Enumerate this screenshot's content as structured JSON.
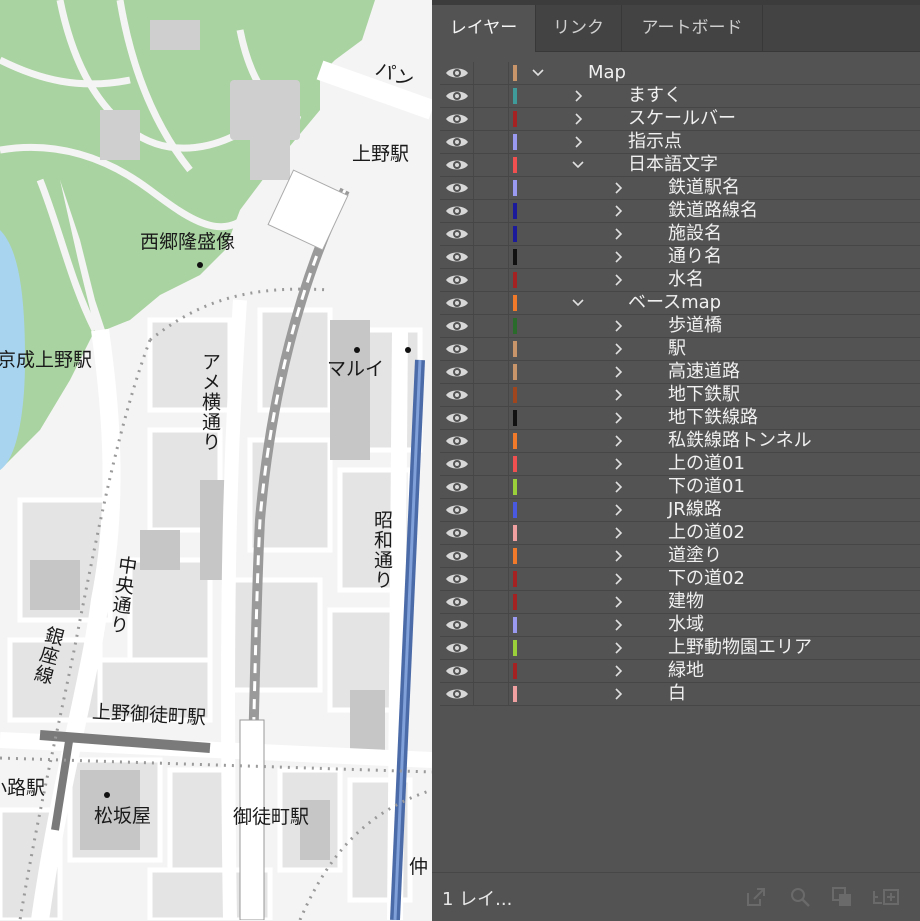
{
  "map": {
    "labels": {
      "pan": "パン",
      "ueno_station": "上野駅",
      "saigo": "西郷隆盛像",
      "keisei": "京成上野駅",
      "ame": "アメ横通り",
      "marui": "マルイ",
      "chuo": "中央通り",
      "showa": "昭和通り",
      "ginza": "銀座線",
      "okachimachi_ueno": "上野御徒町駅",
      "okachimachi": "御徒町駅",
      "matsuzakaya": "松坂屋",
      "koji": "小路駅",
      "naka": "仲"
    }
  },
  "panel": {
    "tabs": [
      "レイヤー",
      "リンク",
      "アートボード"
    ],
    "active_tab": "レイヤー",
    "layers": [
      {
        "name": "Map",
        "level": 0,
        "expanded": true,
        "color": "#c8956a"
      },
      {
        "name": "ますく",
        "level": 1,
        "expanded": false,
        "color": "#3f9a9a"
      },
      {
        "name": "スケールバー",
        "level": 1,
        "expanded": false,
        "color": "#a52222"
      },
      {
        "name": "指示点",
        "level": 1,
        "expanded": false,
        "color": "#9a9af0"
      },
      {
        "name": "日本語文字",
        "level": 1,
        "expanded": true,
        "color": "#f05050"
      },
      {
        "name": "鉄道駅名",
        "level": 2,
        "expanded": false,
        "color": "#9a9af0"
      },
      {
        "name": "鉄道路線名",
        "level": 2,
        "expanded": false,
        "color": "#1a1a9a"
      },
      {
        "name": "施設名",
        "level": 2,
        "expanded": false,
        "color": "#1a1a9a"
      },
      {
        "name": "通り名",
        "level": 2,
        "expanded": false,
        "color": "#111111"
      },
      {
        "name": "水名",
        "level": 2,
        "expanded": false,
        "color": "#a52222"
      },
      {
        "name": "ベースmap",
        "level": 1,
        "expanded": true,
        "color": "#f07a2a"
      },
      {
        "name": "歩道橋",
        "level": 2,
        "expanded": false,
        "color": "#2a6a2a"
      },
      {
        "name": "駅",
        "level": 2,
        "expanded": false,
        "color": "#c8956a"
      },
      {
        "name": "高速道路",
        "level": 2,
        "expanded": false,
        "color": "#c8956a"
      },
      {
        "name": "地下鉄駅",
        "level": 2,
        "expanded": false,
        "color": "#a0461e"
      },
      {
        "name": "地下鉄線路",
        "level": 2,
        "expanded": false,
        "color": "#111111"
      },
      {
        "name": "私鉄線路トンネル",
        "level": 2,
        "expanded": false,
        "color": "#f07a2a"
      },
      {
        "name": "上の道01",
        "level": 2,
        "expanded": false,
        "color": "#f05050"
      },
      {
        "name": "下の道01",
        "level": 2,
        "expanded": false,
        "color": "#9ad03a"
      },
      {
        "name": "JR線路",
        "level": 2,
        "expanded": false,
        "color": "#4a5ae0"
      },
      {
        "name": "上の道02",
        "level": 2,
        "expanded": false,
        "color": "#f0a0a0"
      },
      {
        "name": "道塗り",
        "level": 2,
        "expanded": false,
        "color": "#f07a2a"
      },
      {
        "name": "下の道02",
        "level": 2,
        "expanded": false,
        "color": "#a52222"
      },
      {
        "name": "建物",
        "level": 2,
        "expanded": false,
        "color": "#a52222"
      },
      {
        "name": "水域",
        "level": 2,
        "expanded": false,
        "color": "#9a9af0"
      },
      {
        "name": "上野動物園エリア",
        "level": 2,
        "expanded": false,
        "color": "#9ad03a"
      },
      {
        "name": "緑地",
        "level": 2,
        "expanded": false,
        "color": "#a52222"
      },
      {
        "name": "白",
        "level": 2,
        "expanded": false,
        "color": "#f0a0a0"
      }
    ],
    "status": "1 レイ...",
    "footer_icons": [
      "export-icon",
      "search-icon",
      "clipping-mask-icon",
      "new-sublayer-icon"
    ]
  }
}
